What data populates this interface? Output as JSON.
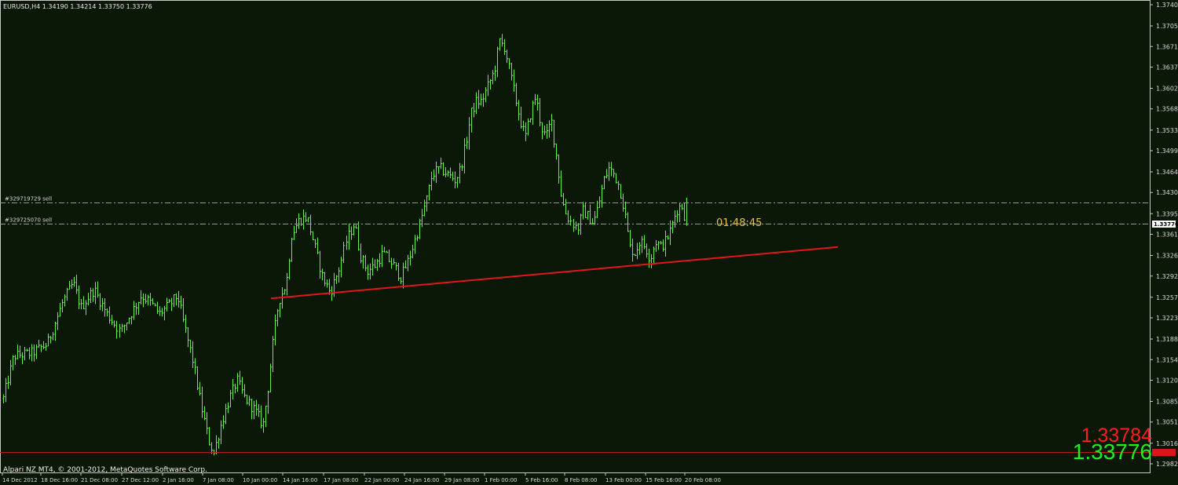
{
  "window": {
    "header": "EURUSD,H4  1.34190 1.34214 1.33750 1.33776",
    "copyright": "Alpari NZ MT4, © 2001-2012, MetaQuotes Software Corp."
  },
  "colors": {
    "background": "#0b1707",
    "candles": "#66f04a",
    "trendline": "#e01818",
    "order_lines": "#8ca08a",
    "ask_text": "#ff1c1c",
    "bid_text": "#1ef01e",
    "timer": "#e6c14a"
  },
  "orders": [
    {
      "label": "#329719729 sell",
      "price": 1.3414
    },
    {
      "label": "#329725070 sell",
      "price": 1.3379
    }
  ],
  "timer": "01:48:45",
  "quote": {
    "ask": "1.33784",
    "bid": "1.33776",
    "current": "1.33776"
  },
  "chart_data": {
    "type": "candlestick",
    "symbol": "EURUSD",
    "timeframe": "H4",
    "ohlc_last": {
      "open": 1.3419,
      "high": 1.34214,
      "low": 1.3375,
      "close": 1.33776
    },
    "y_ticks": [
      "1.37400",
      "1.37050",
      "1.36710",
      "1.36370",
      "1.36020",
      "1.35680",
      "1.35330",
      "1.34990",
      "1.34640",
      "1.34300",
      "1.33950",
      "1.33610",
      "1.33260",
      "1.32920",
      "1.32570",
      "1.32230",
      "1.31880",
      "1.31540",
      "1.31200",
      "1.30850",
      "1.30510",
      "1.30160",
      "1.29820"
    ],
    "ylim": [
      1.2982,
      1.374
    ],
    "x_ticks": [
      "14 Dec 2012",
      "18 Dec 16:00",
      "21 Dec 08:00",
      "27 Dec 12:00",
      "2 Jan 16:00",
      "7 Jan 08:00",
      "10 Jan 00:00",
      "14 Jan 16:00",
      "17 Jan 08:00",
      "22 Jan 00:00",
      "24 Jan 16:00",
      "29 Jan 08:00",
      "1 Feb 00:00",
      "5 Feb 16:00",
      "8 Feb 08:00",
      "13 Feb 00:00",
      "15 Feb 16:00",
      "20 Feb 08:00"
    ],
    "n_candles": 290,
    "path": [
      [
        0,
        1.309
      ],
      [
        8,
        1.316
      ],
      [
        22,
        1.3165
      ],
      [
        34,
        1.318
      ],
      [
        46,
        1.325
      ],
      [
        54,
        1.328
      ],
      [
        60,
        1.324
      ],
      [
        70,
        1.327
      ],
      [
        80,
        1.323
      ],
      [
        90,
        1.32
      ],
      [
        98,
        1.323
      ],
      [
        106,
        1.326
      ],
      [
        112,
        1.325
      ],
      [
        120,
        1.323
      ],
      [
        128,
        1.3245
      ],
      [
        134,
        1.326
      ],
      [
        138,
        1.322
      ],
      [
        146,
        1.315
      ],
      [
        152,
        1.308
      ],
      [
        158,
        1.302
      ],
      [
        162,
        1.3
      ],
      [
        168,
        1.305
      ],
      [
        174,
        1.309
      ],
      [
        180,
        1.312
      ],
      [
        186,
        1.309
      ],
      [
        194,
        1.307
      ],
      [
        200,
        1.3045
      ],
      [
        204,
        1.311
      ],
      [
        208,
        1.319
      ],
      [
        212,
        1.325
      ],
      [
        218,
        1.328
      ],
      [
        222,
        1.336
      ],
      [
        228,
        1.3385
      ],
      [
        234,
        1.339
      ],
      [
        240,
        1.334
      ],
      [
        246,
        1.329
      ],
      [
        252,
        1.3265
      ],
      [
        258,
        1.33
      ],
      [
        264,
        1.335
      ],
      [
        270,
        1.338
      ],
      [
        274,
        1.333
      ],
      [
        280,
        1.33
      ],
      [
        286,
        1.331
      ],
      [
        292,
        1.333
      ],
      [
        300,
        1.331
      ],
      [
        306,
        1.329
      ],
      [
        312,
        1.332
      ],
      [
        318,
        1.336
      ],
      [
        322,
        1.339
      ],
      [
        326,
        1.342
      ],
      [
        330,
        1.346
      ],
      [
        336,
        1.347
      ],
      [
        342,
        1.346
      ],
      [
        348,
        1.345
      ],
      [
        352,
        1.347
      ],
      [
        356,
        1.351
      ],
      [
        360,
        1.356
      ],
      [
        364,
        1.358
      ],
      [
        368,
        1.358
      ],
      [
        372,
        1.36
      ],
      [
        378,
        1.363
      ],
      [
        382,
        1.368
      ],
      [
        386,
        1.367
      ],
      [
        390,
        1.363
      ],
      [
        394,
        1.359
      ],
      [
        398,
        1.355
      ],
      [
        402,
        1.352
      ],
      [
        406,
        1.356
      ],
      [
        410,
        1.359
      ],
      [
        414,
        1.354
      ],
      [
        418,
        1.352
      ],
      [
        422,
        1.355
      ],
      [
        426,
        1.349
      ],
      [
        430,
        1.342
      ],
      [
        434,
        1.339
      ],
      [
        438,
        1.338
      ],
      [
        442,
        1.337
      ],
      [
        446,
        1.34
      ],
      [
        450,
        1.339
      ],
      [
        454,
        1.338
      ],
      [
        458,
        1.341
      ],
      [
        462,
        1.345
      ],
      [
        466,
        1.347
      ],
      [
        470,
        1.346
      ],
      [
        474,
        1.344
      ],
      [
        478,
        1.34
      ],
      [
        482,
        1.334
      ],
      [
        486,
        1.333
      ],
      [
        490,
        1.335
      ],
      [
        494,
        1.334
      ],
      [
        498,
        1.332
      ],
      [
        502,
        1.335
      ],
      [
        506,
        1.334
      ],
      [
        510,
        1.335
      ],
      [
        514,
        1.337
      ],
      [
        518,
        1.34
      ],
      [
        522,
        1.341
      ],
      [
        526,
        1.3378
      ]
    ],
    "trendline": {
      "start": [
        345,
        1.3255
      ],
      "end": [
        1067,
        1.334
      ]
    }
  }
}
